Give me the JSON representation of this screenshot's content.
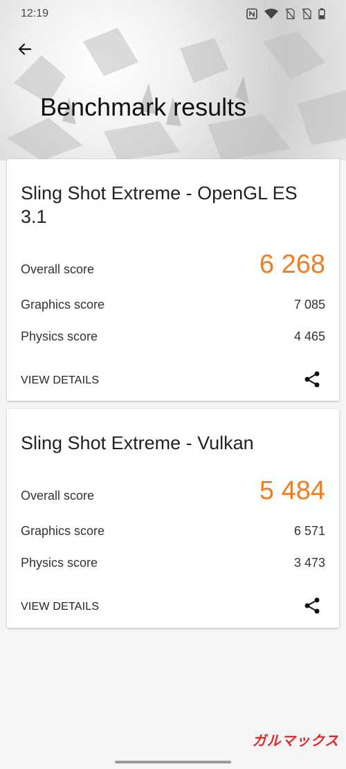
{
  "status_bar": {
    "time": "12:19"
  },
  "header": {
    "title": "Benchmark results"
  },
  "cards": [
    {
      "title": "Sling Shot Extreme - OpenGL ES 3.1",
      "overall_label": "Overall score",
      "overall_value": "6 268",
      "graphics_label": "Graphics score",
      "graphics_value": "7 085",
      "physics_label": "Physics score",
      "physics_value": "4 465",
      "view_details": "VIEW DETAILS"
    },
    {
      "title": "Sling Shot Extreme - Vulkan",
      "overall_label": "Overall score",
      "overall_value": "5 484",
      "graphics_label": "Graphics score",
      "graphics_value": "6 571",
      "physics_label": "Physics score",
      "physics_value": "3 473",
      "view_details": "VIEW DETAILS"
    }
  ],
  "watermark": "ガルマックス",
  "colors": {
    "accent": "#f47c20",
    "watermark": "#e02828"
  }
}
